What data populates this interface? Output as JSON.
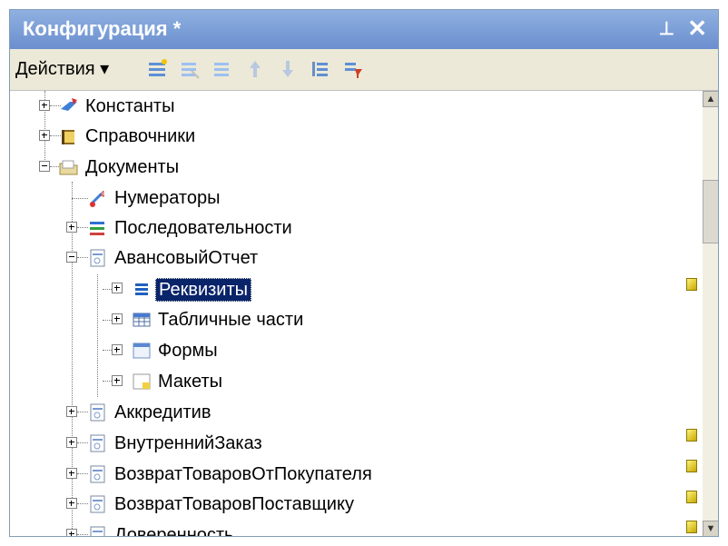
{
  "window": {
    "title": "Конфигурация *"
  },
  "toolbar": {
    "actions_label": "Действия ▾",
    "icons": [
      "add-icon",
      "add-group-icon",
      "copy-icon",
      "move-up-icon",
      "move-down-icon",
      "sort-icon",
      "filter-icon"
    ]
  },
  "tree": {
    "nodes": [
      {
        "label": "Константы"
      },
      {
        "label": "Справочники"
      },
      {
        "label": "Документы"
      },
      {
        "label": "Нумераторы"
      },
      {
        "label": "Последовательности"
      },
      {
        "label": "АвансовыйОтчет"
      },
      {
        "label": "Реквизиты",
        "selected": true
      },
      {
        "label": "Табличные части"
      },
      {
        "label": "Формы"
      },
      {
        "label": "Макеты"
      },
      {
        "label": "Аккредитив"
      },
      {
        "label": "ВнутреннийЗаказ"
      },
      {
        "label": "ВозвратТоваровОтПокупателя"
      },
      {
        "label": "ВозвратТоваровПоставщику"
      },
      {
        "label": "Доверенность"
      }
    ]
  },
  "colors": {
    "title_bar": "#6b8fcf",
    "selection": "#0a246a"
  }
}
